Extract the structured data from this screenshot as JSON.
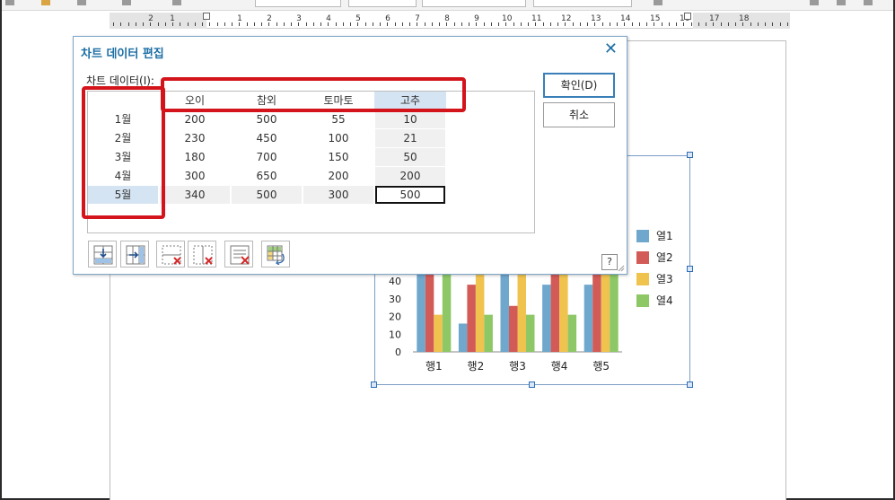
{
  "dialog": {
    "title": "차트 데이터 편집",
    "close": "✕",
    "data_label": "차트 데이터(I):",
    "ok_label": "확인(D)",
    "cancel_label": "취소",
    "help_label": "?"
  },
  "grid": {
    "headers": [
      "오이",
      "참외",
      "토마토",
      "고추"
    ],
    "rows": [
      {
        "label": "1월",
        "values": [
          "200",
          "500",
          "55",
          "10"
        ]
      },
      {
        "label": "2월",
        "values": [
          "230",
          "450",
          "100",
          "21"
        ]
      },
      {
        "label": "3월",
        "values": [
          "180",
          "700",
          "150",
          "50"
        ]
      },
      {
        "label": "4월",
        "values": [
          "300",
          "650",
          "200",
          "200"
        ]
      },
      {
        "label": "5월",
        "values": [
          "340",
          "500",
          "300",
          "500"
        ]
      }
    ],
    "active_cell": "500"
  },
  "tools": [
    {
      "name": "insert-row-icon"
    },
    {
      "name": "insert-column-icon"
    },
    {
      "name": "delete-row-icon"
    },
    {
      "name": "delete-column-icon"
    },
    {
      "name": "delete-data-icon"
    },
    {
      "name": "swap-rows-columns-icon"
    }
  ],
  "ruler": {
    "numbers": [
      "2",
      "1",
      "1",
      "2",
      "3",
      "4",
      "5",
      "6",
      "7",
      "8",
      "9",
      "10",
      "11",
      "12",
      "13",
      "14",
      "15",
      "16",
      "17",
      "18"
    ]
  },
  "chart_data": {
    "type": "bar",
    "categories": [
      "행1",
      "행2",
      "행3",
      "행4",
      "행5"
    ],
    "yticks": [
      "40",
      "30",
      "20",
      "10",
      "0"
    ],
    "series": [
      {
        "name": "열1",
        "values": [
          60,
          16,
          60,
          38,
          38
        ]
      },
      {
        "name": "열2",
        "values": [
          60,
          38,
          26,
          60,
          60
        ]
      },
      {
        "name": "열3",
        "values": [
          21,
          60,
          60,
          60,
          60
        ]
      },
      {
        "name": "열4",
        "values": [
          60,
          21,
          21,
          21,
          60
        ]
      }
    ],
    "ylim": [
      0,
      50
    ],
    "colors": [
      "#6fa7cd",
      "#d25a57",
      "#f0c34f",
      "#8dc766"
    ]
  }
}
